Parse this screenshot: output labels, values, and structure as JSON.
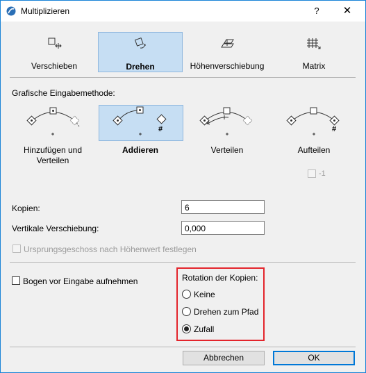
{
  "window": {
    "title": "Multiplizieren",
    "help_label": "?",
    "close_label": "✕"
  },
  "modes": [
    {
      "label": "Verschieben",
      "icon": "move-icon",
      "selected": false
    },
    {
      "label": "Drehen",
      "icon": "rotate-icon",
      "selected": true
    },
    {
      "label": "Höhenverschiebung",
      "icon": "elevate-icon",
      "selected": false
    },
    {
      "label": "Matrix",
      "icon": "matrix-icon",
      "selected": false
    }
  ],
  "input_method": {
    "heading": "Grafische Eingabemethode:",
    "options": [
      {
        "label": "Hinzufügen und Verteilen",
        "selected": false
      },
      {
        "label": "Addieren",
        "selected": true,
        "marker": "#"
      },
      {
        "label": "Verteilen",
        "selected": false
      },
      {
        "label": "Aufteilen",
        "selected": false,
        "marker": "#"
      }
    ],
    "minus_one_label": "-1"
  },
  "copies": {
    "label": "Kopien:",
    "value": "6"
  },
  "vertical_offset": {
    "label": "Vertikale Verschiebung:",
    "value": "0,000"
  },
  "origin_story": {
    "label": "Ursprungsgeschoss nach Höhenwert festlegen",
    "checked": false,
    "enabled": false
  },
  "arc_before_input": {
    "label": "Bogen vor Eingabe aufnehmen",
    "checked": false
  },
  "rotation": {
    "heading": "Rotation der Kopien:",
    "options": [
      {
        "label": "Keine",
        "selected": false
      },
      {
        "label": "Drehen zum Pfad",
        "selected": false
      },
      {
        "label": "Zufall",
        "selected": true
      }
    ]
  },
  "buttons": {
    "cancel": "Abbrechen",
    "ok": "OK"
  },
  "colors": {
    "accent": "#0078d7",
    "selection": "#c6def3",
    "highlight_frame": "#e3242b"
  }
}
